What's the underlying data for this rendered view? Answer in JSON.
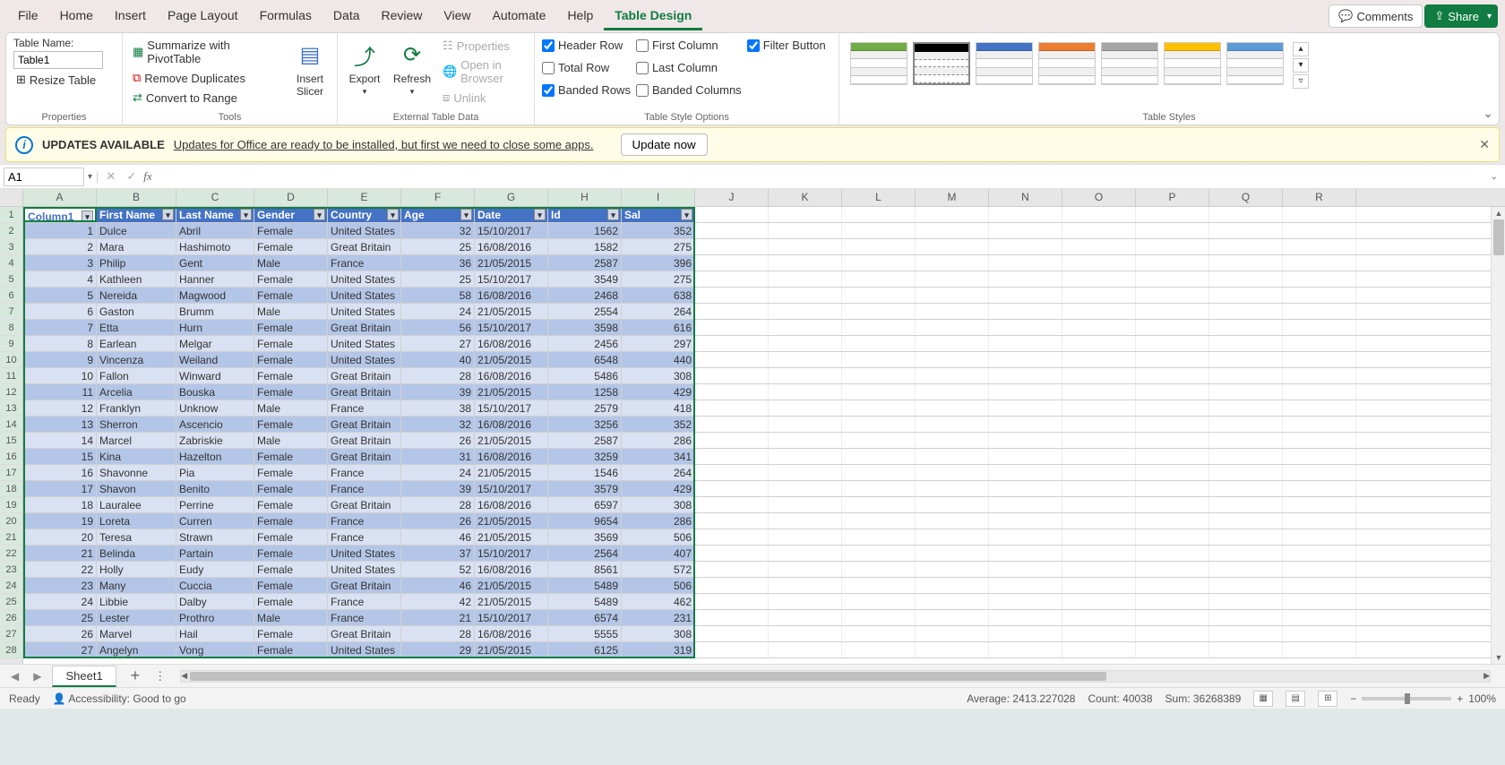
{
  "menubar": {
    "items": [
      "File",
      "Home",
      "Insert",
      "Page Layout",
      "Formulas",
      "Data",
      "Review",
      "View",
      "Automate",
      "Help",
      "Table Design"
    ],
    "active_index": 10,
    "comments": "Comments",
    "share": "Share"
  },
  "ribbon": {
    "properties": {
      "label": "Properties",
      "table_name_label": "Table Name:",
      "table_name_value": "Table1",
      "resize": "Resize Table"
    },
    "tools": {
      "label": "Tools",
      "pivot": "Summarize with PivotTable",
      "dup": "Remove Duplicates",
      "range": "Convert to Range",
      "slicer": "Insert\nSlicer"
    },
    "ext": {
      "label": "External Table Data",
      "export": "Export",
      "refresh": "Refresh",
      "props": "Properties",
      "browser": "Open in Browser",
      "unlink": "Unlink"
    },
    "options": {
      "label": "Table Style Options",
      "header_row": "Header Row",
      "total_row": "Total Row",
      "banded_rows": "Banded Rows",
      "first_col": "First Column",
      "last_col": "Last Column",
      "banded_cols": "Banded Columns",
      "filter": "Filter Button",
      "checked": {
        "header_row": true,
        "total_row": false,
        "banded_rows": true,
        "first_col": false,
        "last_col": false,
        "banded_cols": false,
        "filter": true
      }
    },
    "styles": {
      "label": "Table Styles"
    }
  },
  "msgbar": {
    "title": "UPDATES AVAILABLE",
    "text": "Updates for Office are ready to be installed, but first we need to close some apps.",
    "button": "Update now"
  },
  "formula_bar": {
    "name_box": "A1",
    "formula": ""
  },
  "grid": {
    "col_widths": {
      "A": 82,
      "B": 89,
      "C": 87,
      "D": 82,
      "E": 82,
      "F": 82,
      "G": 82,
      "H": 82,
      "I": 82,
      "J": 82,
      "K": 82,
      "L": 82,
      "M": 82,
      "N": 82,
      "O": 82,
      "P": 82,
      "Q": 82,
      "R": 82
    },
    "col_letters": [
      "A",
      "B",
      "C",
      "D",
      "E",
      "F",
      "G",
      "H",
      "I",
      "J",
      "K",
      "L",
      "M",
      "N",
      "O",
      "P",
      "Q",
      "R"
    ],
    "table_cols": 9,
    "headers": [
      "Column1",
      "First Name",
      "Last Name",
      "Gender",
      "Country",
      "Age",
      "Date",
      "Id",
      "Sal"
    ],
    "rows": [
      [
        1,
        "Dulce",
        "Abril",
        "Female",
        "United States",
        32,
        "15/10/2017",
        1562,
        352
      ],
      [
        2,
        "Mara",
        "Hashimoto",
        "Female",
        "Great Britain",
        25,
        "16/08/2016",
        1582,
        275
      ],
      [
        3,
        "Philip",
        "Gent",
        "Male",
        "France",
        36,
        "21/05/2015",
        2587,
        396
      ],
      [
        4,
        "Kathleen",
        "Hanner",
        "Female",
        "United States",
        25,
        "15/10/2017",
        3549,
        275
      ],
      [
        5,
        "Nereida",
        "Magwood",
        "Female",
        "United States",
        58,
        "16/08/2016",
        2468,
        638
      ],
      [
        6,
        "Gaston",
        "Brumm",
        "Male",
        "United States",
        24,
        "21/05/2015",
        2554,
        264
      ],
      [
        7,
        "Etta",
        "Hurn",
        "Female",
        "Great Britain",
        56,
        "15/10/2017",
        3598,
        616
      ],
      [
        8,
        "Earlean",
        "Melgar",
        "Female",
        "United States",
        27,
        "16/08/2016",
        2456,
        297
      ],
      [
        9,
        "Vincenza",
        "Weiland",
        "Female",
        "United States",
        40,
        "21/05/2015",
        6548,
        440
      ],
      [
        10,
        "Fallon",
        "Winward",
        "Female",
        "Great Britain",
        28,
        "16/08/2016",
        5486,
        308
      ],
      [
        11,
        "Arcelia",
        "Bouska",
        "Female",
        "Great Britain",
        39,
        "21/05/2015",
        1258,
        429
      ],
      [
        12,
        "Franklyn",
        "Unknow",
        "Male",
        "France",
        38,
        "15/10/2017",
        2579,
        418
      ],
      [
        13,
        "Sherron",
        "Ascencio",
        "Female",
        "Great Britain",
        32,
        "16/08/2016",
        3256,
        352
      ],
      [
        14,
        "Marcel",
        "Zabriskie",
        "Male",
        "Great Britain",
        26,
        "21/05/2015",
        2587,
        286
      ],
      [
        15,
        "Kina",
        "Hazelton",
        "Female",
        "Great Britain",
        31,
        "16/08/2016",
        3259,
        341
      ],
      [
        16,
        "Shavonne",
        "Pia",
        "Female",
        "France",
        24,
        "21/05/2015",
        1546,
        264
      ],
      [
        17,
        "Shavon",
        "Benito",
        "Female",
        "France",
        39,
        "15/10/2017",
        3579,
        429
      ],
      [
        18,
        "Lauralee",
        "Perrine",
        "Female",
        "Great Britain",
        28,
        "16/08/2016",
        6597,
        308
      ],
      [
        19,
        "Loreta",
        "Curren",
        "Female",
        "France",
        26,
        "21/05/2015",
        9654,
        286
      ],
      [
        20,
        "Teresa",
        "Strawn",
        "Female",
        "France",
        46,
        "21/05/2015",
        3569,
        506
      ],
      [
        21,
        "Belinda",
        "Partain",
        "Female",
        "United States",
        37,
        "15/10/2017",
        2564,
        407
      ],
      [
        22,
        "Holly",
        "Eudy",
        "Female",
        "United States",
        52,
        "16/08/2016",
        8561,
        572
      ],
      [
        23,
        "Many",
        "Cuccia",
        "Female",
        "Great Britain",
        46,
        "21/05/2015",
        5489,
        506
      ],
      [
        24,
        "Libbie",
        "Dalby",
        "Female",
        "France",
        42,
        "21/05/2015",
        5489,
        462
      ],
      [
        25,
        "Lester",
        "Prothro",
        "Male",
        "France",
        21,
        "15/10/2017",
        6574,
        231
      ],
      [
        26,
        "Marvel",
        "Hail",
        "Female",
        "Great Britain",
        28,
        "16/08/2016",
        5555,
        308
      ],
      [
        27,
        "Angelyn",
        "Vong",
        "Female",
        "United States",
        29,
        "21/05/2015",
        6125,
        319
      ]
    ],
    "numeric_cols": [
      0,
      5,
      7,
      8
    ]
  },
  "sheetbar": {
    "tab": "Sheet1"
  },
  "statusbar": {
    "ready": "Ready",
    "accessibility": "Accessibility: Good to go",
    "average": "Average: 2413.227028",
    "count": "Count: 40038",
    "sum": "Sum: 36268389",
    "zoom": "100%"
  },
  "style_colors": [
    "#70ad47",
    "#000000",
    "#4472c4",
    "#ed7d31",
    "#a5a5a5",
    "#ffc000",
    "#5b9bd5"
  ]
}
